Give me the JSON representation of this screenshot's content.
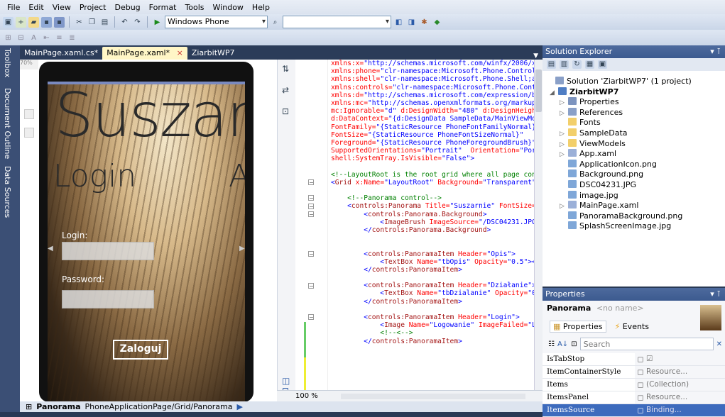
{
  "menu": [
    "File",
    "Edit",
    "View",
    "Project",
    "Debug",
    "Format",
    "Tools",
    "Window",
    "Help"
  ],
  "toolbar": {
    "target_combo": "Windows Phone Emulator",
    "search_combo": ""
  },
  "left_strip": {
    "toolbox": "Toolbox",
    "doc_outline": "Document Outline",
    "data_sources": "Data Sources"
  },
  "doc_tabs": [
    {
      "label": "MainPage.xaml.cs*",
      "active": false
    },
    {
      "label": "MainPage.xaml*",
      "active": true
    },
    {
      "label": "ZiarbitWP7",
      "active": false
    }
  ],
  "doc_tab_close": "×",
  "designer": {
    "zoom_box": "70%",
    "panorama_title": "Suszar",
    "header": "Login",
    "header_next": "A",
    "login_label": "Login:",
    "password_label": "Password:",
    "login_button": "Zaloguj"
  },
  "code": {
    "zoom": "100 %",
    "lines": [
      [
        [
          "a",
          "xmlns:x="
        ],
        [
          "v",
          "\"http://schemas.microsoft.com/winfx/2006/xa"
        ]
      ],
      [
        [
          "a",
          "xmlns:phone="
        ],
        [
          "v",
          "\"clr-namespace:Microsoft.Phone.Controls"
        ]
      ],
      [
        [
          "a",
          "xmlns:shell="
        ],
        [
          "v",
          "\"clr-namespace:Microsoft.Phone.Shell;as"
        ]
      ],
      [
        [
          "a",
          "xmlns:controls="
        ],
        [
          "v",
          "\"clr-namespace:Microsoft.Phone.Contr"
        ]
      ],
      [
        [
          "a",
          "xmlns:d="
        ],
        [
          "v",
          "\"http://schemas.microsoft.com/expression/b"
        ]
      ],
      [
        [
          "a",
          "xmlns:mc="
        ],
        [
          "v",
          "\"http://schemas.openxmlformats.org/markup-"
        ]
      ],
      [
        [
          "a",
          "mc:Ignorable="
        ],
        [
          "v",
          "\"d\""
        ],
        [
          "a",
          " d:DesignWidth="
        ],
        [
          "v",
          "\"480\""
        ],
        [
          "a",
          " d:DesignHeigh"
        ]
      ],
      [
        [
          "a",
          "d:DataContext="
        ],
        [
          "v",
          "\"{d:DesignData SampleData/MainViewMod"
        ]
      ],
      [
        [
          "a",
          "FontFamily="
        ],
        [
          "v",
          "\"{StaticResource PhoneFontFamilyNormal}\""
        ]
      ],
      [
        [
          "a",
          "FontSize="
        ],
        [
          "v",
          "\"{StaticResource PhoneFontSizeNormal}\""
        ]
      ],
      [
        [
          "a",
          "Foreground="
        ],
        [
          "v",
          "\"{StaticResource PhoneForegroundBrush}\""
        ],
        [
          "p",
          ">"
        ]
      ],
      [
        [
          "a",
          "SupportedOrientations="
        ],
        [
          "v",
          "\"Portrait\""
        ],
        [
          "a",
          "  Orientation="
        ],
        [
          "v",
          "\"Port"
        ]
      ],
      [
        [
          "a",
          "shell:SystemTray.IsVisible="
        ],
        [
          "v",
          "\"False\""
        ],
        [
          "p",
          ">"
        ]
      ],
      [],
      [
        [
          "c",
          "<!--LayoutRoot is the root grid where all page cont"
        ]
      ],
      [
        [
          "p",
          "<"
        ],
        [
          "k",
          "Grid"
        ],
        [
          "a",
          " x:Name="
        ],
        [
          "v",
          "\"LayoutRoot\""
        ],
        [
          "a",
          " Background="
        ],
        [
          "v",
          "\"Transparent\""
        ],
        [
          "p",
          "\">"
        ]
      ],
      [],
      [
        [
          "c",
          "    <!--Panorama control-->"
        ]
      ],
      [
        [
          "p",
          "    <"
        ],
        [
          "k",
          "controls:Panorama"
        ],
        [
          "a",
          " Title="
        ],
        [
          "v",
          "\"Suszarnie\""
        ],
        [
          "a",
          " FontSize="
        ]
      ],
      [
        [
          "p",
          "        <"
        ],
        [
          "k",
          "controls:Panorama.Background"
        ],
        [
          "p",
          ">"
        ]
      ],
      [
        [
          "p",
          "            <"
        ],
        [
          "k",
          "ImageBrush"
        ],
        [
          "a",
          " ImageSource="
        ],
        [
          "v",
          "\"/DSC04231.JPG\""
        ]
      ],
      [
        [
          "p",
          "        </"
        ],
        [
          "k",
          "controls:Panorama.Background"
        ],
        [
          "p",
          ">"
        ]
      ],
      [],
      [],
      [
        [
          "p",
          "        <"
        ],
        [
          "k",
          "controls:PanoramaItem"
        ],
        [
          "a",
          " Header="
        ],
        [
          "v",
          "\"Opis\""
        ],
        [
          "p",
          ">"
        ]
      ],
      [
        [
          "p",
          "            <"
        ],
        [
          "k",
          "TextBox"
        ],
        [
          "a",
          " Name="
        ],
        [
          "v",
          "\"tbOpis\""
        ],
        [
          "a",
          " Opacity="
        ],
        [
          "v",
          "\"0.5\""
        ],
        [
          "p",
          "></"
        ]
      ],
      [
        [
          "p",
          "        </"
        ],
        [
          "k",
          "controls:PanoramaItem"
        ],
        [
          "p",
          ">"
        ]
      ],
      [],
      [
        [
          "p",
          "        <"
        ],
        [
          "k",
          "controls:PanoramaItem"
        ],
        [
          "a",
          " Header="
        ],
        [
          "v",
          "\"Działanie\""
        ],
        [
          "p",
          ">"
        ]
      ],
      [
        [
          "p",
          "            <"
        ],
        [
          "k",
          "TextBox"
        ],
        [
          "a",
          " Name="
        ],
        [
          "v",
          "\"tbDzialanie\""
        ],
        [
          "a",
          " Opacity="
        ],
        [
          "v",
          "\"0"
        ]
      ],
      [
        [
          "p",
          "        </"
        ],
        [
          "k",
          "controls:PanoramaItem"
        ],
        [
          "p",
          ">"
        ]
      ],
      [],
      [
        [
          "p",
          "        <"
        ],
        [
          "k",
          "controls:PanoramaItem"
        ],
        [
          "a",
          " Header="
        ],
        [
          "v",
          "\"Login\""
        ],
        [
          "p",
          ">"
        ]
      ],
      [
        [
          "p",
          "            <"
        ],
        [
          "k",
          "Image"
        ],
        [
          "a",
          " Name="
        ],
        [
          "v",
          "\"Logowanie\""
        ],
        [
          "a",
          " ImageFailed="
        ],
        [
          "v",
          "\"Lo"
        ]
      ],
      [
        [
          "c",
          "            <!--<-->"
        ]
      ],
      [
        [
          "p",
          "        </"
        ],
        [
          "k",
          "controls:PanoramaItem"
        ],
        [
          "p",
          ">"
        ]
      ]
    ]
  },
  "status": {
    "panorama": "Panorama",
    "path": "PhoneApplicationPage/Grid/Panorama"
  },
  "solution_explorer": {
    "title": "Solution Explorer",
    "solution": "Solution 'ZiarbitWP7' (1 project)",
    "project": "ZiarbitWP7",
    "items": [
      {
        "label": "Properties",
        "kind": "props",
        "expand": true
      },
      {
        "label": "References",
        "kind": "refs",
        "expand": true
      },
      {
        "label": "Fonts",
        "kind": "folder",
        "expand": false
      },
      {
        "label": "SampleData",
        "kind": "folder",
        "expand": true
      },
      {
        "label": "ViewModels",
        "kind": "folder",
        "expand": true
      },
      {
        "label": "App.xaml",
        "kind": "xaml",
        "expand": true
      },
      {
        "label": "ApplicationIcon.png",
        "kind": "img",
        "expand": false
      },
      {
        "label": "Background.png",
        "kind": "img",
        "expand": false
      },
      {
        "label": "DSC04231.JPG",
        "kind": "img",
        "expand": false
      },
      {
        "label": "image.jpg",
        "kind": "img",
        "expand": false
      },
      {
        "label": "MainPage.xaml",
        "kind": "xaml",
        "expand": true
      },
      {
        "label": "PanoramaBackground.png",
        "kind": "img",
        "expand": false
      },
      {
        "label": "SplashScreenImage.jpg",
        "kind": "img",
        "expand": false
      }
    ]
  },
  "properties": {
    "title": "Properties",
    "object_type": "Panorama",
    "object_name": "<no name>",
    "tab_properties": "Properties",
    "tab_events": "Events",
    "search_placeholder": "Search",
    "rows": [
      {
        "name": "IsTabStop",
        "value": "☑",
        "selected": false
      },
      {
        "name": "ItemContainerStyle",
        "value": "Resource...",
        "selected": false
      },
      {
        "name": "Items",
        "value": "(Collection)",
        "selected": false
      },
      {
        "name": "ItemsPanel",
        "value": "Resource...",
        "selected": false
      },
      {
        "name": "ItemsSource",
        "value": "Binding...",
        "selected": true
      }
    ]
  }
}
